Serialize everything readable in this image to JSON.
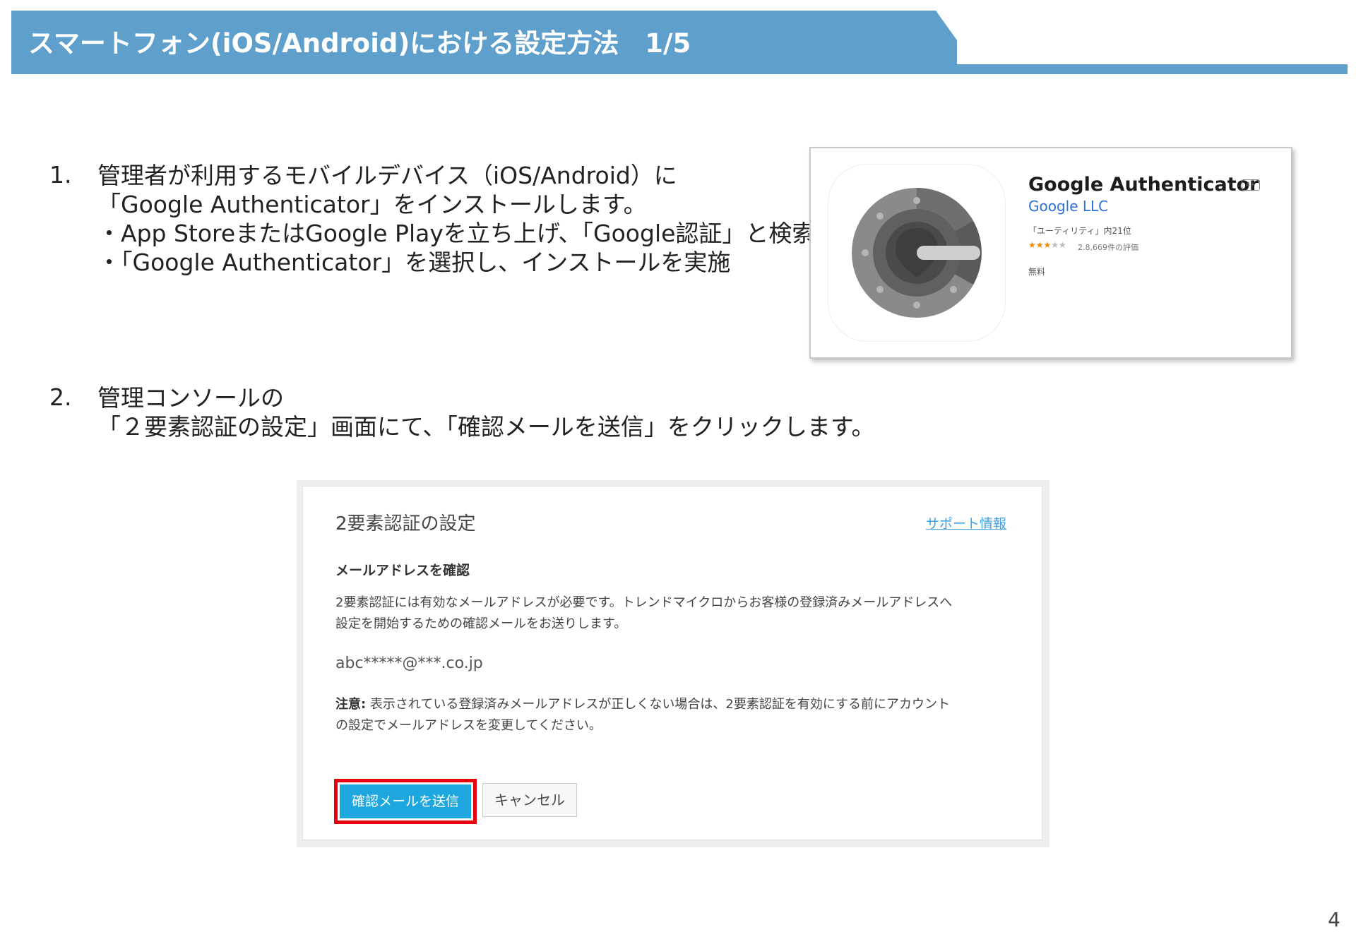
{
  "header": {
    "title": "スマートフォン(iOS/Android)における設定方法　1/5"
  },
  "steps": [
    {
      "number": "1.",
      "lines": [
        "管理者が利用するモバイルデバイス（iOS/Android）に",
        "「Google Authenticator」をインストールします。",
        "・App StoreまたはGoogle Playを立ち上げ、「Google認証」と検索",
        "・「Google Authenticator」を選択し、インストールを実施"
      ]
    },
    {
      "number": "2.",
      "lines": [
        "管理コンソールの",
        "「２要素認証の設定」画面にて、「確認メールを送信」をクリックします。"
      ]
    }
  ],
  "app_card": {
    "name": "Google Authenticator",
    "age_rating": "4+",
    "developer": "Google LLC",
    "rank": "「ユーティリティ」内21位",
    "stars_filled": "★★★",
    "stars_empty": "★★",
    "ratings": "2.8,669件の評価",
    "price": "無料"
  },
  "dialog": {
    "title": "2要素認証の設定",
    "support_link": "サポート情報",
    "subheading": "メールアドレスを確認",
    "description_lines": [
      "2要素認証には有効なメールアドレスが必要です。トレンドマイクロからお客様の登録済みメールアドレスへ",
      "設定を開始するための確認メールをお送りします。"
    ],
    "email": "abc*****@***.co.jp",
    "note_label": "注意:",
    "note_lines": [
      "表示されている登録済みメールアドレスが正しくない場合は、2要素認証を有効にする前にアカウント",
      "の設定でメールアドレスを変更してください。"
    ],
    "send_button": "確認メールを送信",
    "cancel_button": "キャンセル"
  },
  "page_number": "4",
  "colors": {
    "header": "#5f9fcb",
    "send_button": "#1ea6de",
    "highlight": "#e8000f",
    "link": "#3fa0dd"
  }
}
